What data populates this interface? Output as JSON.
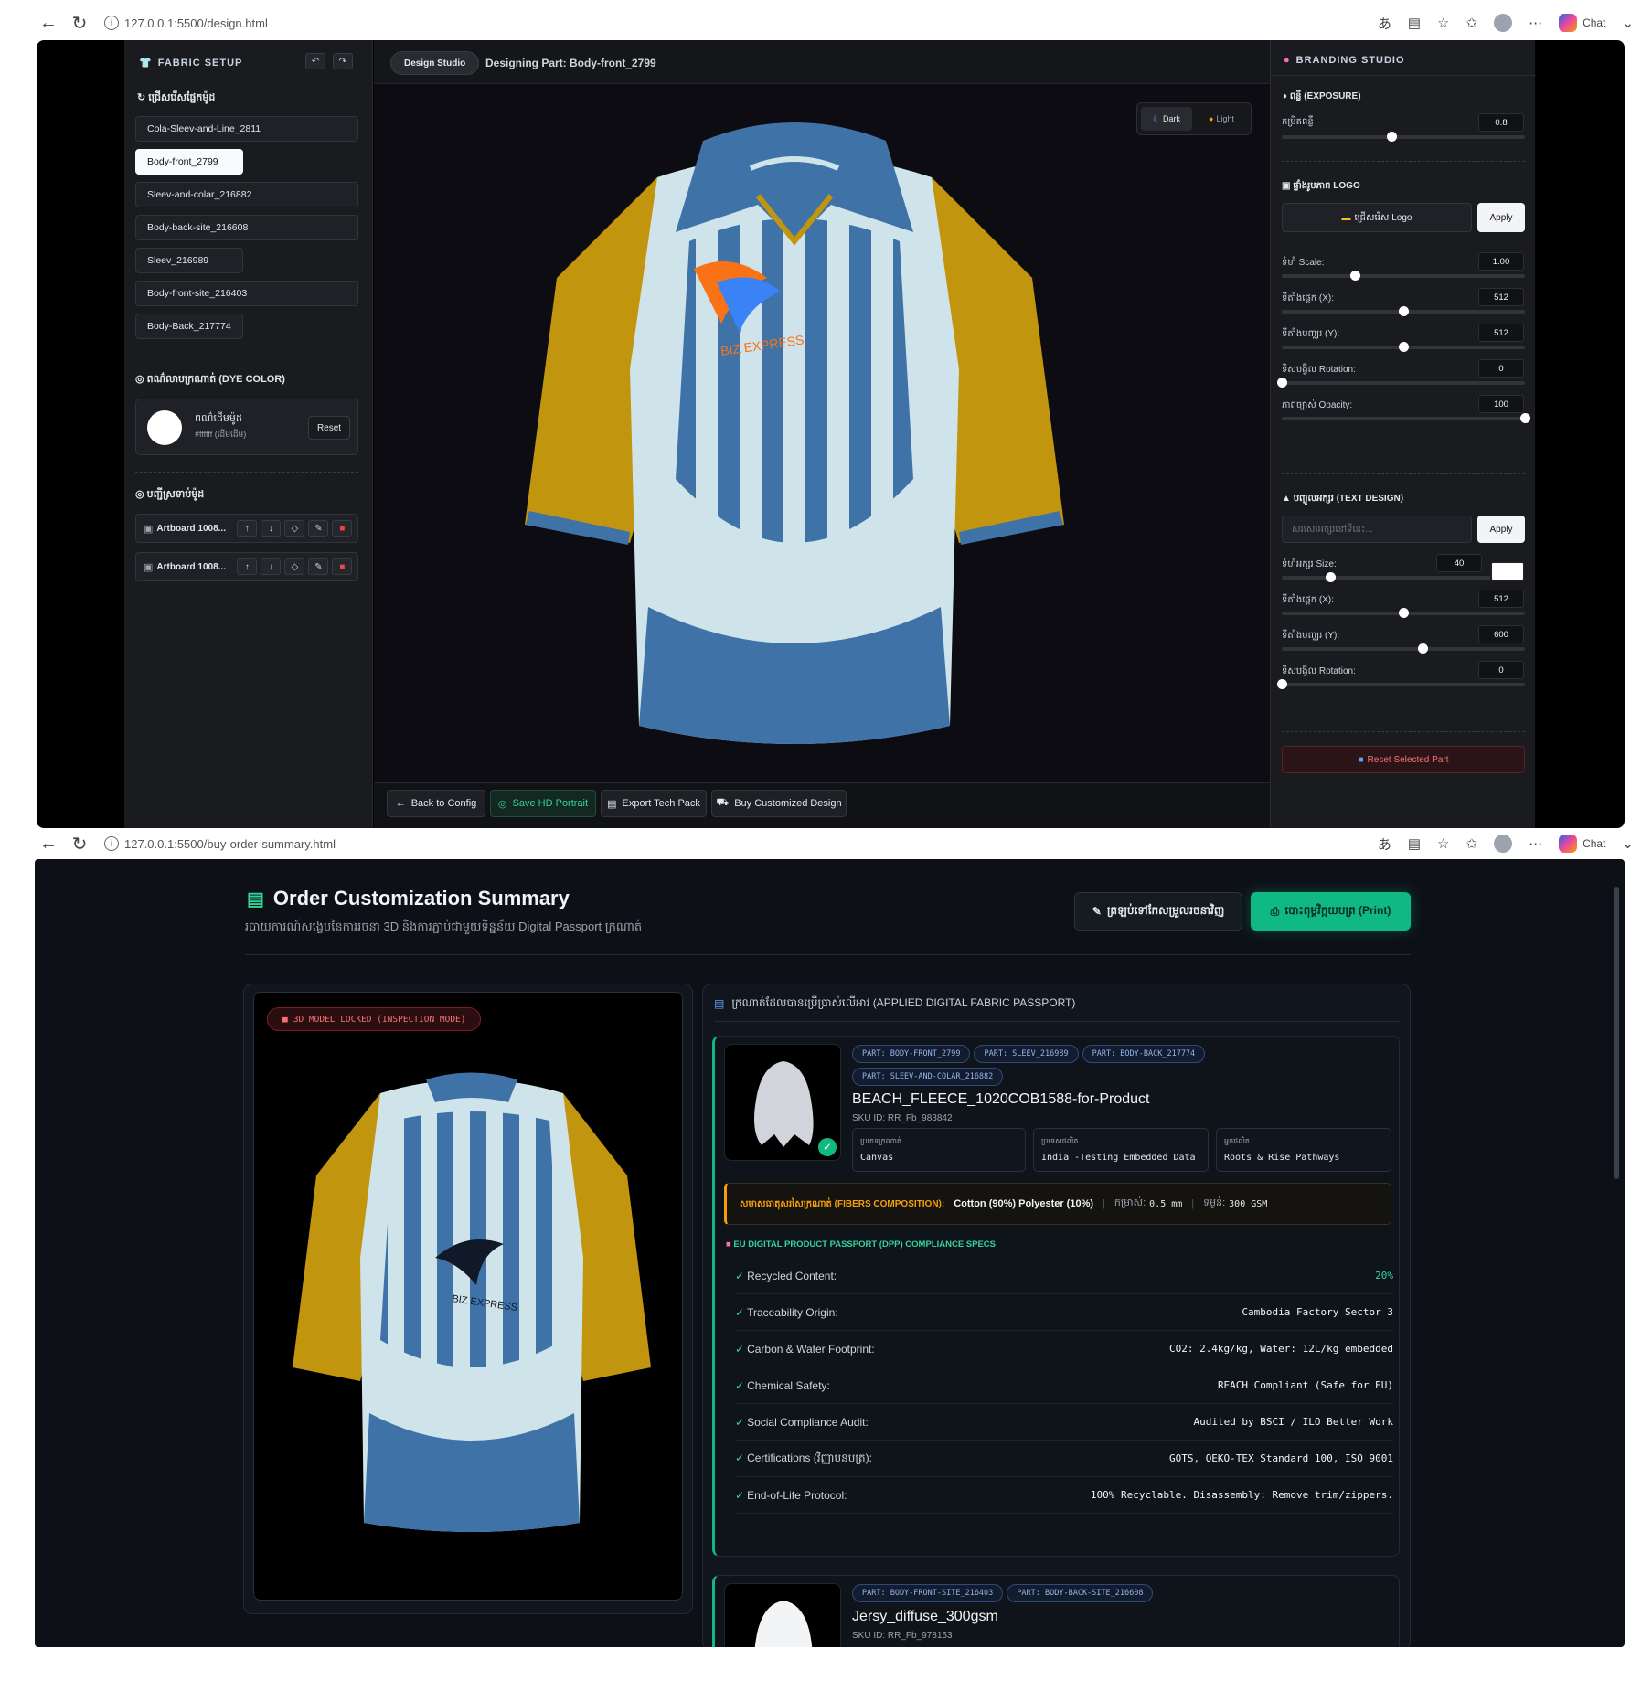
{
  "browser1": {
    "url": "127.0.0.1:5500/design.html",
    "chat": "Chat"
  },
  "browser2": {
    "url": "127.0.0.1:5500/buy-order-summary.html",
    "chat": "Chat"
  },
  "fabric_setup": {
    "title": "FABRIC SETUP",
    "select_part_label": "ជ្រើសរើសផ្នែកម៉ូដ",
    "parts": [
      "Cola-Sleev-and-Line_2811",
      "Body-front_2799",
      "Sleev-and-colar_216882",
      "Body-back-site_216608",
      "Sleev_216989",
      "Body-front-site_216403",
      "Body-Back_217774"
    ],
    "dye_label": "ពណ៌លាបក្រណាត់ (DYE COLOR)",
    "dye_name": "ពណ៌ដើមម៉ូដ",
    "dye_hex": "#ffffff (ដើមដើម)",
    "reset": "Reset",
    "artboards_label": "បញ្ជីស្រទាប់ម៉ូដ",
    "artboards": [
      "Artboard 1008...",
      "Artboard 1008..."
    ]
  },
  "studio": {
    "tab": "Design Studio",
    "designing": "Designing Part: Body-front_2799",
    "dark": "Dark",
    "light": "Light",
    "back": "Back to Config",
    "save": "Save HD Portrait",
    "export": "Export Tech Pack",
    "buy": "Buy Customized Design",
    "logo_text": "BIZ EXPRESS"
  },
  "branding": {
    "title": "BRANDING STUDIO",
    "exposure_label": "ពន្លឺ (EXPOSURE)",
    "intensity_label": "កម្រិតពន្លឺ",
    "intensity_value": "0.8",
    "intensity_level": 0.45,
    "logo_label": "ផ្ទាំងរូបភាព LOGO",
    "choose_logo": "ជ្រើសរើស Logo",
    "apply": "Apply",
    "logo_rows": [
      {
        "label": "ទំហំ Scale:",
        "value": "1.00",
        "level": 0.3
      },
      {
        "label": "ទីតាំងផ្តេក (X):",
        "value": "512",
        "level": 0.5
      },
      {
        "label": "ទីតាំងបញ្ឈរ (Y):",
        "value": "512",
        "level": 0.5
      },
      {
        "label": "ទិសបង្វិល Rotation:",
        "value": "0",
        "level": 0
      },
      {
        "label": "ភាពច្បាស់ Opacity:",
        "value": "100",
        "level": 1
      }
    ],
    "text_label": "បញ្ចូលអក្សរ (TEXT DESIGN)",
    "text_placeholder": "សរសេរអក្សរនៅទីនេះ...",
    "text_apply": "Apply",
    "text_rows": [
      {
        "label": "ទំហំអក្សរ Size:",
        "value": "40",
        "level": 0.2
      },
      {
        "label": "ទីតាំងផ្តេក (X):",
        "value": "512",
        "level": 0.5
      },
      {
        "label": "ទីតាំងបញ្ឈរ (Y):",
        "value": "600",
        "level": 0.58
      },
      {
        "label": "ទិសបង្វិល Rotation:",
        "value": "0",
        "level": 0
      }
    ],
    "text_color": "#ffffff",
    "reset_part": "Reset Selected Part"
  },
  "summary": {
    "title": "Order Customization Summary",
    "subtitle": "របាយការណ៍សង្ខេបនៃការរចនា 3D និងការភ្ជាប់ជាមួយទិន្នន័យ Digital Passport ក្រណាត់",
    "back_btn": "ត្រឡប់ទៅកែសម្រួលរចនាវិញ",
    "print_btn": "បោះពុម្ពវិក្កយបត្រ (Print)",
    "locked": "3D MODEL LOCKED (INSPECTION MODE)",
    "passport_title": "ក្រណាត់ដែលបានប្រើប្រាស់លើអាវ (APPLIED DIGITAL FABRIC PASSPORT)",
    "fabric1": {
      "parts": [
        "PART: BODY-FRONT_2799",
        "PART: SLEEV_216989",
        "PART: BODY-BACK_217774",
        "PART: SLEEV-AND-COLAR_216882"
      ],
      "name": "BEACH_FLEECE_1020COB1588-for-Product",
      "sku": "SKU ID: RR_Fb_983842",
      "info": [
        {
          "t": "ប្រភេទក្រណាត់",
          "d": "Canvas"
        },
        {
          "t": "ប្រទេសផលិត",
          "d": "India -Testing Embedded Data"
        },
        {
          "t": "អ្នកផលិត",
          "d": "Roots & Rise Pathways"
        }
      ],
      "fibers_label": "សមាសធាតុសរសៃក្រណាត់ (FIBERS COMPOSITION):",
      "fibers": "Cotton (90%) Polyester (10%)",
      "thickness_label": "កម្រាស់:",
      "thickness": "0.5 mm",
      "weight_label": "ទម្ងន់:",
      "weight": "300 GSM",
      "dpp_title": "EU DIGITAL PRODUCT PASSPORT (DPP) COMPLIANCE SPECS",
      "dpp": [
        {
          "k": "Recycled Content:",
          "v": "20%"
        },
        {
          "k": "Traceability Origin:",
          "v": "Cambodia Factory Sector 3"
        },
        {
          "k": "Carbon & Water Footprint:",
          "v": "CO2: 2.4kg/kg, Water: 12L/kg embedded"
        },
        {
          "k": "Chemical Safety:",
          "v": "REACH Compliant (Safe for EU)"
        },
        {
          "k": "Social Compliance Audit:",
          "v": "Audited by BSCI / ILO Better Work"
        },
        {
          "k": "Certifications (វិញ្ញាបនបត្រ):",
          "v": "GOTS, OEKO-TEX Standard 100, ISO 9001"
        },
        {
          "k": "End-of-Life Protocol:",
          "v": "100% Recyclable. Disassembly: Remove trim/zippers."
        }
      ]
    },
    "fabric2": {
      "parts": [
        "PART: BODY-FRONT-SITE_216403",
        "PART: BODY-BACK-SITE_216608"
      ],
      "name": "Jersy_diffuse_300gsm",
      "sku": "SKU ID: RR_Fb_978153"
    },
    "back_logo": "BIZ EXPRESS"
  },
  "colors": {
    "accent_green": "#10b981",
    "blue_stripe": "#3f73a8",
    "white_stripe": "#cfe3ea",
    "yellow_sleeve": "#c2950f",
    "danger": "#ef4444"
  }
}
